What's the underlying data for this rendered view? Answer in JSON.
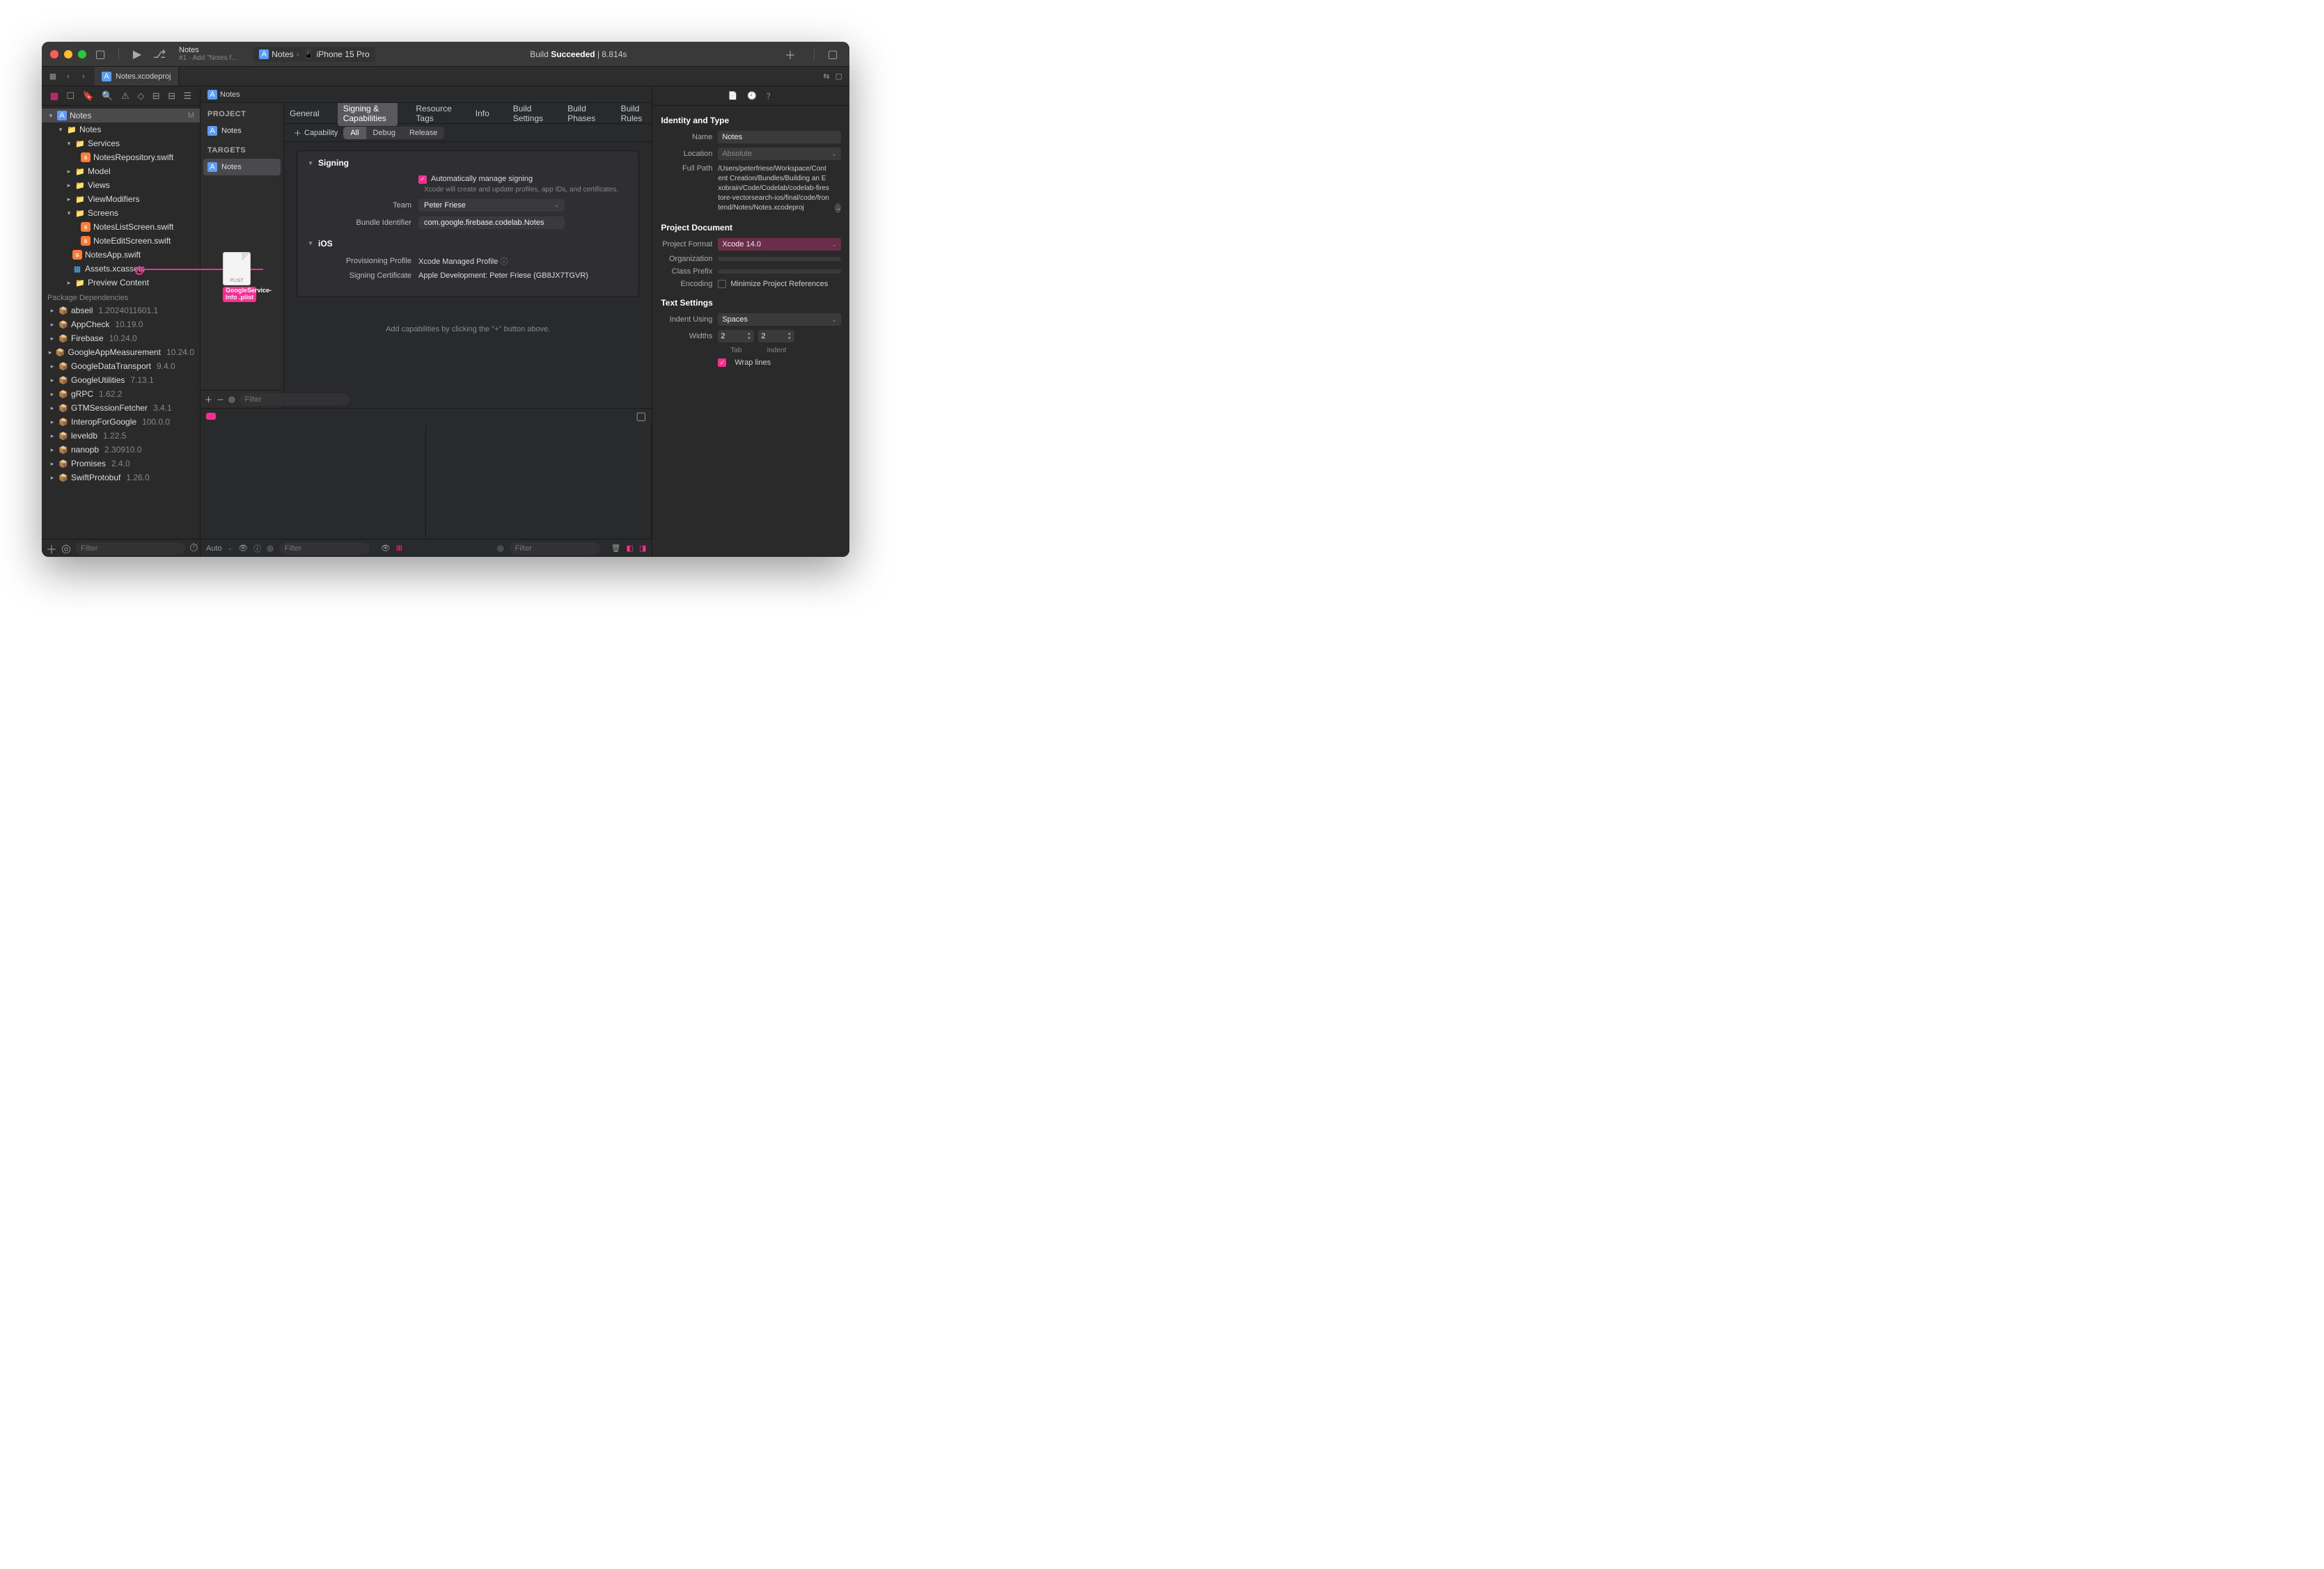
{
  "titlebar": {
    "scheme_name": "Notes",
    "scheme_sub": "#1 · Add \"Notes f…",
    "dest_app": "Notes",
    "dest_device": "iPhone 15 Pro",
    "status_prefix": "Build ",
    "status_bold": "Succeeded",
    "status_time": " | 8.814s"
  },
  "tabs": {
    "active": "Notes.xcodeproj"
  },
  "crumbs": {
    "item": "Notes"
  },
  "navigator": {
    "root": "Notes",
    "root_badge": "M",
    "app_group": "Notes",
    "services": "Services",
    "notes_repo": "NotesRepository.swift",
    "model": "Model",
    "views": "Views",
    "viewmods": "ViewModifiers",
    "screens": "Screens",
    "notes_list": "NotesListScreen.swift",
    "note_edit": "NoteEditScreen.swift",
    "notes_app": "NotesApp.swift",
    "assets": "Assets.xcassets",
    "preview": "Preview Content",
    "pkg_header": "Package Dependencies",
    "packages": [
      {
        "name": "abseil",
        "ver": "1.2024011601.1"
      },
      {
        "name": "AppCheck",
        "ver": "10.19.0"
      },
      {
        "name": "Firebase",
        "ver": "10.24.0"
      },
      {
        "name": "GoogleAppMeasurement",
        "ver": "10.24.0"
      },
      {
        "name": "GoogleDataTransport",
        "ver": "9.4.0"
      },
      {
        "name": "GoogleUtilities",
        "ver": "7.13.1"
      },
      {
        "name": "gRPC",
        "ver": "1.62.2"
      },
      {
        "name": "GTMSessionFetcher",
        "ver": "3.4.1"
      },
      {
        "name": "InteropForGoogle",
        "ver": "100.0.0"
      },
      {
        "name": "leveldb",
        "ver": "1.22.5"
      },
      {
        "name": "nanopb",
        "ver": "2.30910.0"
      },
      {
        "name": "Promises",
        "ver": "2.4.0"
      },
      {
        "name": "SwiftProtobuf",
        "ver": "1.26.0"
      }
    ],
    "filter_ph": "Filter"
  },
  "targets": {
    "project_label": "PROJECT",
    "project_item": "Notes",
    "targets_label": "TARGETS",
    "target_item": "Notes",
    "filter_ph": "Filter"
  },
  "settings_tabs": {
    "general": "General",
    "signing": "Signing & Capabilities",
    "resource": "Resource Tags",
    "info": "Info",
    "build_settings": "Build Settings",
    "build_phases": "Build Phases",
    "build_rules": "Build Rules"
  },
  "cap_bar": {
    "add_cap": "Capability",
    "all": "All",
    "debug": "Debug",
    "release": "Release"
  },
  "signing": {
    "section": "Signing",
    "auto_label": "Automatically manage signing",
    "auto_desc": "Xcode will create and update profiles, app IDs, and certificates.",
    "team_lbl": "Team",
    "team_val": "Peter Friese",
    "bundle_lbl": "Bundle Identifier",
    "bundle_val": "com.google.firebase.codelab.Notes",
    "ios_section": "iOS",
    "prov_lbl": "Provisioning Profile",
    "prov_val": "Xcode Managed Profile",
    "cert_lbl": "Signing Certificate",
    "cert_val": "Apple Development: Peter Friese (GB8JX7TGVR)",
    "hint": "Add capabilities by clicking the \"+\" button above."
  },
  "debugbar": {
    "auto": "Auto",
    "filter_ph": "Filter"
  },
  "inspector": {
    "identity": "Identity and Type",
    "name_lbl": "Name",
    "name_val": "Notes",
    "loc_lbl": "Location",
    "loc_val": "Absolute",
    "path_lbl": "Full Path",
    "path_val": "/Users/peterfriese/Workspace/Content Creation/Bundles/Building an Exobrain/Code/Codelab/codelab-firestore-vectorsearch-ios/final/code/frontend/Notes/Notes.xcodeproj",
    "projdoc": "Project Document",
    "format_lbl": "Project Format",
    "format_val": "Xcode 14.0",
    "org_lbl": "Organization",
    "prefix_lbl": "Class Prefix",
    "enc_lbl": "Encoding",
    "enc_val": "Minimize Project References",
    "text": "Text Settings",
    "indent_lbl": "Indent Using",
    "indent_val": "Spaces",
    "widths_lbl": "Widths",
    "tab_w": "2",
    "indent_w": "2",
    "tab_cap": "Tab",
    "indent_cap": "Indent",
    "wrap": "Wrap lines"
  },
  "drag": {
    "filetype": "PLIST",
    "label": "GoogleService-Info .plist"
  }
}
